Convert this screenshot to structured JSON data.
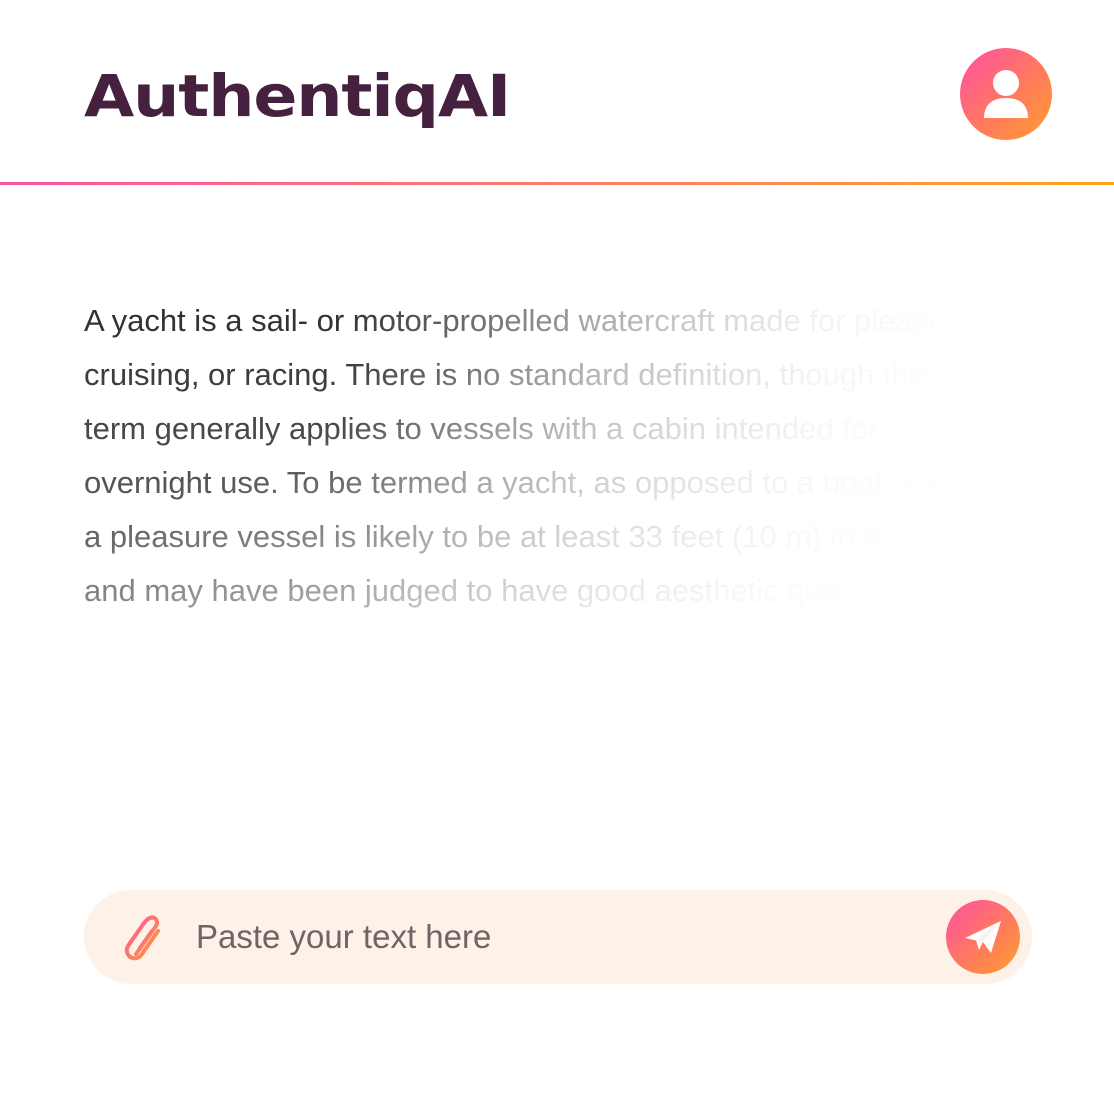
{
  "app": {
    "name": "AuthentiqAI"
  },
  "header": {
    "avatar_icon": "user-icon"
  },
  "article": {
    "text": "A yacht is a sail- or motor-propelled watercraft made for pleasure, cruising, or racing. There is no standard definition, though the term generally applies to vessels with a cabin intended for overnight use. To be termed a yacht, as opposed to a boat, such a pleasure vessel is likely to be at least 33 feet (10 m) in length and may have been judged to have good aesthetic qualities."
  },
  "composer": {
    "placeholder": "Paste your text here",
    "attach_icon": "paperclip-icon",
    "send_icon": "paper-plane-icon"
  },
  "colors": {
    "brand_dark": "#46213f",
    "gradient_start": "#ff4fa6",
    "gradient_end": "#ff9f2e",
    "composer_bg": "#fdf1e8",
    "placeholder_text": "#6f6466"
  }
}
